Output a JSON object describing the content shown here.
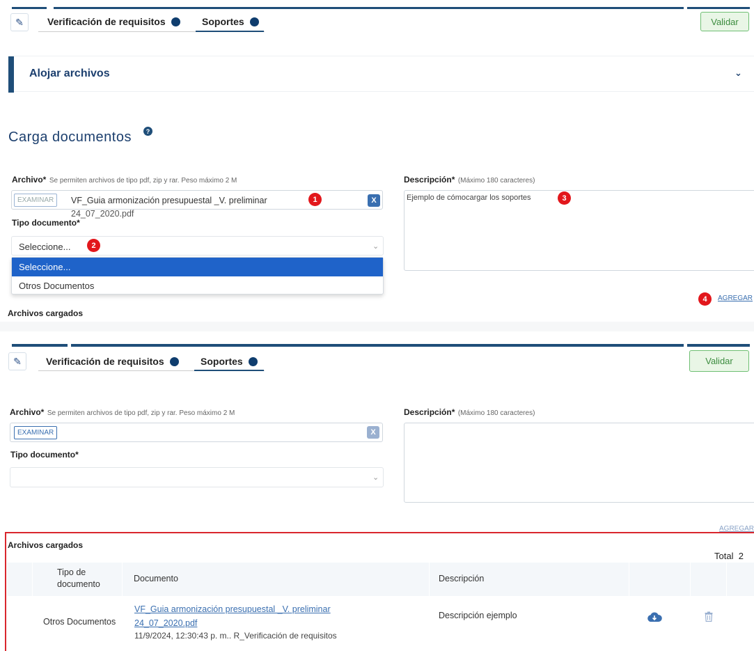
{
  "top": {
    "tabs": [
      {
        "label": "Verificación de requisitos"
      },
      {
        "label": "Soportes"
      }
    ],
    "validar_label": "Validar"
  },
  "accordion": {
    "title": "Alojar archivos"
  },
  "section": {
    "title": "Carga documentos"
  },
  "form": {
    "archivo_label": "Archivo*",
    "archivo_hint": "Se permiten archivos de tipo pdf, zip y rar. Peso máximo 2 M",
    "examinar_label": "EXAMINAR",
    "file_value_line1": "VF_Guia armonización presupuestal _V. preliminar",
    "file_value_line2": "24_07_2020.pdf",
    "clear_label": "X",
    "tipo_label": "Tipo documento*",
    "tipo_selected": "Seleccione...",
    "tipo_options": [
      "Seleccione...",
      "Otros Documentos"
    ],
    "desc_label": "Descripción*",
    "desc_hint": "(Máximo 180 caracteres)",
    "desc_value": "Ejemplo de cómocargar los soportes",
    "agregar_label": "AGREGAR",
    "archivos_cargados_label": "Archivos cargados"
  },
  "steps": [
    "1",
    "2",
    "3",
    "4"
  ],
  "table": {
    "title": "Archivos cargados",
    "total_label": "Total",
    "total_value": "2",
    "headers": [
      "Tipo de documento",
      "Documento",
      "Descripción"
    ],
    "rows": [
      {
        "tipo": "Otros Documentos",
        "doc_line1": "VF_Guia armonización presupuestal _V. preliminar",
        "doc_line2": "24_07_2020.pdf",
        "doc_meta": "11/9/2024, 12:30:43 p. m.. R_Verificación de requisitos",
        "descripcion": "Descripción ejemplo"
      }
    ]
  },
  "colors": {
    "accent": "#1f4e79",
    "link": "#3a6fb0",
    "step_badge": "#e2171c",
    "highlight_border": "#d9262d"
  }
}
